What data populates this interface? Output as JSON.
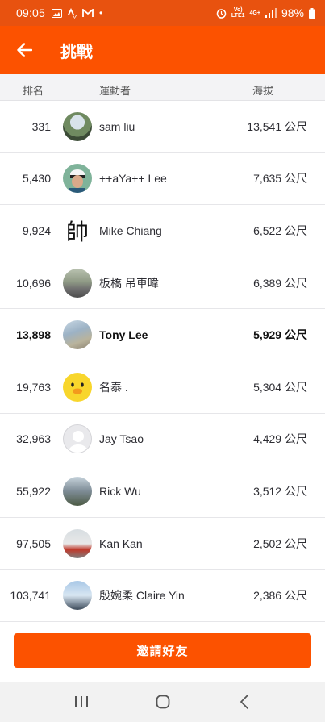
{
  "status_bar": {
    "time": "09:05",
    "volte_top": "Vo)",
    "volte_bottom": "LTE1",
    "network": "4G+",
    "battery": "98%"
  },
  "app_bar": {
    "title": "挑戰"
  },
  "table": {
    "headers": {
      "rank": "排名",
      "athlete": "運動者",
      "elevation": "海拔"
    },
    "rows": [
      {
        "rank": "331",
        "name": "sam liu",
        "elevation": "13,541 公尺"
      },
      {
        "rank": "5,430",
        "name": "++aYa++ Lee",
        "elevation": "7,635 公尺"
      },
      {
        "rank": "9,924",
        "name": "Mike Chiang",
        "elevation": "6,522 公尺",
        "avatar_glyph": "帥"
      },
      {
        "rank": "10,696",
        "name": "板橋 吊車暐",
        "elevation": "6,389 公尺"
      },
      {
        "rank": "13,898",
        "name": "Tony Lee",
        "elevation": "5,929 公尺"
      },
      {
        "rank": "19,763",
        "name": "名泰 .",
        "elevation": "5,304 公尺"
      },
      {
        "rank": "32,963",
        "name": "Jay Tsao",
        "elevation": "4,429 公尺"
      },
      {
        "rank": "55,922",
        "name": "Rick Wu",
        "elevation": "3,512 公尺"
      },
      {
        "rank": "97,505",
        "name": "Kan Kan",
        "elevation": "2,502 公尺"
      },
      {
        "rank": "103,741",
        "name": "殷婉柔 Claire Yin",
        "elevation": "2,386 公尺"
      }
    ]
  },
  "invite_button": {
    "label": "邀請好友"
  },
  "colors": {
    "accent": "#fc5200",
    "status_bar": "#e8520f"
  },
  "icons": {
    "back": "arrow-left-icon",
    "recent_apps": "recent-apps-icon",
    "home": "home-icon",
    "nav_back": "chevron-left-icon"
  }
}
